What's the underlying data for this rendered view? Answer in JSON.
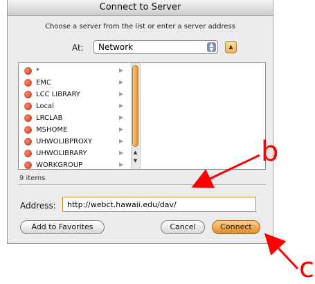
{
  "window": {
    "title": "Connect to Server"
  },
  "instructions": "Choose a server from the list or enter a server address",
  "location": {
    "label": "At:",
    "selected": "Network"
  },
  "server_list": {
    "items": [
      {
        "label": "*"
      },
      {
        "label": "EMC"
      },
      {
        "label": "LCC LIBRARY"
      },
      {
        "label": "Local"
      },
      {
        "label": "LRCLAB"
      },
      {
        "label": "MSHOME"
      },
      {
        "label": "UHWOLIBPROXY"
      },
      {
        "label": "UHWOLIBRARY"
      },
      {
        "label": "WORKGROUP"
      }
    ],
    "count_text": "9 items"
  },
  "address": {
    "label": "Address:",
    "value": "http://webct.hawaii.edu/dav/"
  },
  "buttons": {
    "add_favorites": "Add to Favorites",
    "cancel": "Cancel",
    "connect": "Connect"
  },
  "annotations": {
    "b": "b",
    "c": "c",
    "color": "#ff0000"
  }
}
